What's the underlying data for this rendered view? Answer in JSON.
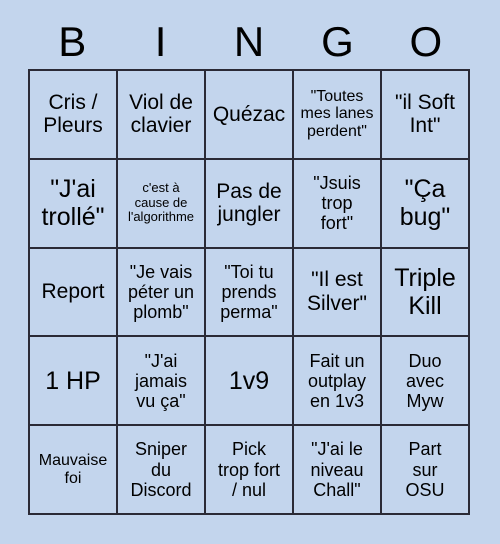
{
  "card": {
    "title": "BINGO",
    "background_color": "#c3d5ed",
    "border_color": "#2a2a36",
    "text_color": "#000000"
  },
  "header": {
    "letters": [
      "B",
      "I",
      "N",
      "G",
      "O"
    ]
  },
  "grid": {
    "columns": 5,
    "rows": 5,
    "cells": [
      {
        "text": "Cris /\nPleurs",
        "size": "fs-lg"
      },
      {
        "text": "Viol de\nclavier",
        "size": "fs-lg"
      },
      {
        "text": "Quézac",
        "size": "fs-lg"
      },
      {
        "text": "\"Toutes\nmes lanes\nperdent\"",
        "size": "fs-sm"
      },
      {
        "text": "\"il Soft\nInt\"",
        "size": "fs-lg"
      },
      {
        "text": "\"J'ai\ntrollé\"",
        "size": "fs-xl"
      },
      {
        "text": "c'est à\ncause de\nl'algorithme",
        "size": "fs-xs"
      },
      {
        "text": "Pas de\njungler",
        "size": "fs-lg"
      },
      {
        "text": "\"Jsuis\ntrop\nfort\"",
        "size": "fs-md"
      },
      {
        "text": "\"Ça\nbug\"",
        "size": "fs-xl"
      },
      {
        "text": "Report",
        "size": "fs-lg"
      },
      {
        "text": "\"Je vais\npéter un\nplomb\"",
        "size": "fs-md"
      },
      {
        "text": "\"Toi tu\nprends\nperma\"",
        "size": "fs-md"
      },
      {
        "text": "\"Il est\nSilver\"",
        "size": "fs-lg"
      },
      {
        "text": "Triple\nKill",
        "size": "fs-xl"
      },
      {
        "text": "1 HP",
        "size": "fs-xl"
      },
      {
        "text": "\"J'ai\njamais\nvu ça\"",
        "size": "fs-md"
      },
      {
        "text": "1v9",
        "size": "fs-xl"
      },
      {
        "text": "Fait un\noutplay\nen 1v3",
        "size": "fs-md"
      },
      {
        "text": "Duo\navec\nMyw",
        "size": "fs-md"
      },
      {
        "text": "Mauvaise\nfoi",
        "size": "fs-sm"
      },
      {
        "text": "Sniper\ndu\nDiscord",
        "size": "fs-md"
      },
      {
        "text": "Pick\ntrop fort\n/ nul",
        "size": "fs-md"
      },
      {
        "text": "\"J'ai le\nniveau\nChall\"",
        "size": "fs-md"
      },
      {
        "text": "Part\nsur\nOSU",
        "size": "fs-md"
      }
    ]
  }
}
